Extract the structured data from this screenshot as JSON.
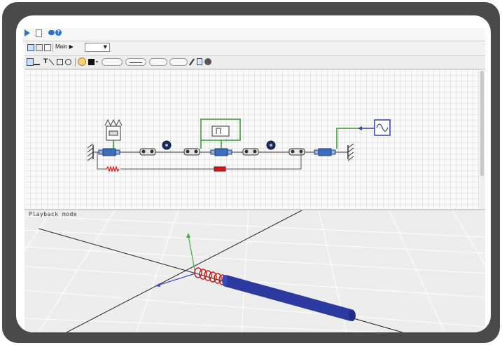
{
  "toolbar": {
    "main_label": "Main",
    "main_arrow": "▶",
    "dropdown_value": "",
    "dropdown_arrow": "▼"
  },
  "icons": {
    "run": "play-icon",
    "document": "document-icon",
    "chat": "chat-icon",
    "help": "help-icon",
    "selection": "pointer-icon",
    "line": "line-icon",
    "text": "text-icon",
    "rectangle": "rectangle-icon",
    "ellipse": "ellipse-icon",
    "fill_color": "fill-color-icon",
    "line_color": "line-color-icon",
    "line_style": "line-style-icon",
    "arrow_style": "arrow-style-icon",
    "pen": "pen-icon"
  },
  "view3d": {
    "status": "Playback mode"
  },
  "colors": {
    "frame": "#4a4a4b",
    "connection_green": "#2d9a2d",
    "connection_blue": "#2b3fae",
    "spring_red": "#d21a1a",
    "rod_blue": "#2c3aa0",
    "axis_green": "#3fae3f",
    "axis_blue": "#3b46c8"
  }
}
